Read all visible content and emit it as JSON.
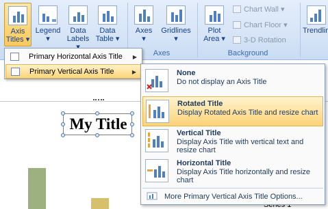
{
  "ribbon": {
    "axis_titles": "Axis Titles",
    "legend": "Legend",
    "data_labels": "Data Labels",
    "data_table": "Data Table",
    "axes": "Axes",
    "gridlines": "Gridlines",
    "plot_area": "Plot Area",
    "chart_wall": "Chart Wall",
    "chart_floor": "Chart Floor",
    "rotation_3d": "3-D Rotation",
    "trendline": "Trendlin",
    "group_axes": "Axes",
    "group_background": "Background"
  },
  "submenu": {
    "item_horizontal": "Primary Horizontal Axis Title",
    "item_vertical": "Primary Vertical Axis Title"
  },
  "flyout": {
    "items": [
      {
        "title": "None",
        "desc": "Do not display an Axis Title"
      },
      {
        "title": "Rotated Title",
        "desc": "Display Rotated Axis Title and resize chart"
      },
      {
        "title": "Vertical Title",
        "desc": "Display Axis Title with vertical text and resize chart"
      },
      {
        "title": "Horizontal Title",
        "desc": "Display Axis Title horizontally and resize chart"
      }
    ],
    "more": "More Primary Vertical Axis Title Options..."
  },
  "chart": {
    "title": "My Title",
    "series_label": "Series 1",
    "bar_colors": [
      "#9cb080",
      "#d6c06c"
    ]
  }
}
